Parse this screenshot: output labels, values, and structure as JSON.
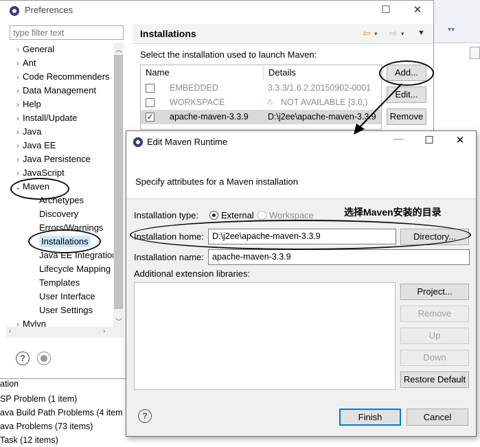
{
  "preferences": {
    "title": "Preferences",
    "filter_placeholder": "type filter text",
    "tree": [
      {
        "label": "General",
        "kind": "collapsed"
      },
      {
        "label": "Ant",
        "kind": "collapsed"
      },
      {
        "label": "Code Recommenders",
        "kind": "collapsed"
      },
      {
        "label": "Data Management",
        "kind": "collapsed"
      },
      {
        "label": "Help",
        "kind": "collapsed"
      },
      {
        "label": "Install/Update",
        "kind": "collapsed"
      },
      {
        "label": "Java",
        "kind": "collapsed"
      },
      {
        "label": "Java EE",
        "kind": "collapsed"
      },
      {
        "label": "Java Persistence",
        "kind": "collapsed"
      },
      {
        "label": "JavaScript",
        "kind": "collapsed"
      },
      {
        "label": "Maven",
        "kind": "expanded"
      },
      {
        "label": "Archetypes",
        "kind": "child"
      },
      {
        "label": "Discovery",
        "kind": "child"
      },
      {
        "label": "Errors/Warnings",
        "kind": "child"
      },
      {
        "label": "Installations",
        "kind": "child",
        "selected": true
      },
      {
        "label": "Java EE Integration",
        "kind": "child"
      },
      {
        "label": "Lifecycle Mapping",
        "kind": "child"
      },
      {
        "label": "Templates",
        "kind": "child"
      },
      {
        "label": "User Interface",
        "kind": "child"
      },
      {
        "label": "User Settings",
        "kind": "child"
      },
      {
        "label": "Mylyn",
        "kind": "collapsed"
      }
    ],
    "page": {
      "title": "Installations",
      "description": "Select the installation used to launch Maven:",
      "columns": [
        "Name",
        "Details"
      ],
      "rows": [
        {
          "checked": false,
          "name": "EMBEDDED",
          "details": "3.3.3/1.6.2.20150902-0001",
          "gray": true,
          "warning": false
        },
        {
          "checked": false,
          "name": "WORKSPACE",
          "details": "NOT AVAILABLE [3.0,)",
          "gray": true,
          "warning": true
        },
        {
          "checked": true,
          "name": "apache-maven-3.3.9",
          "details": "D:\\j2ee\\apache-maven-3.3.9",
          "gray": false,
          "warning": false,
          "selected": true
        }
      ],
      "buttons": {
        "add": "Add...",
        "edit": "Edit...",
        "remove": "Remove"
      }
    }
  },
  "dialog": {
    "title": "Edit Maven Runtime",
    "subtitle": "Specify attributes for a Maven installation",
    "installation_type_label": "Installation type:",
    "type_external": "External",
    "type_workspace": "Workspace",
    "home_label": "Installation home:",
    "home_value": "D:\\j2ee\\apache-maven-3.3.9",
    "directory_button": "Directory...",
    "name_label": "Installation name:",
    "name_value": "apache-maven-3.3.9",
    "ext_label": "Additional extension libraries:",
    "side_buttons": {
      "project": "Project...",
      "remove": "Remove",
      "up": "Up",
      "down": "Down",
      "restore": "Restore Default"
    },
    "finish": "Finish",
    "cancel": "Cancel"
  },
  "annotation_text": "选择Maven安装的目录",
  "background": {
    "problems": [
      "ation",
      "SP Problem (1 item)",
      "ava Build Path Problems (4 item",
      "ava Problems (73 items)",
      "Task (12 items)"
    ]
  }
}
